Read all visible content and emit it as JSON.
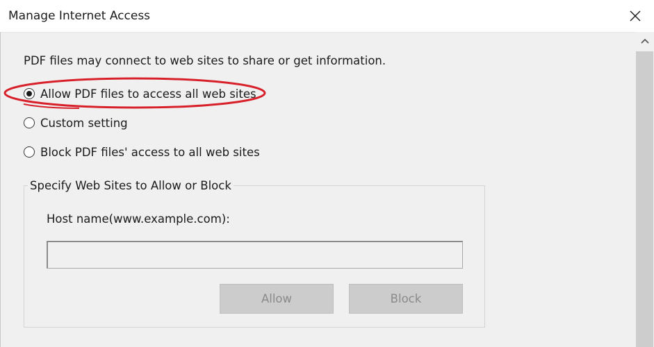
{
  "window": {
    "title": "Manage Internet Access",
    "close_icon": "close-icon"
  },
  "description": "PDF files may connect to web sites to share or get information.",
  "options": [
    {
      "label": "Allow PDF files to access all web sites",
      "selected": true
    },
    {
      "label": "Custom setting",
      "selected": false
    },
    {
      "label": "Block PDF files' access to all web sites",
      "selected": false
    }
  ],
  "group": {
    "title": "Specify Web Sites to Allow or Block",
    "host_label": "Host name(www.example.com):",
    "host_value": "",
    "allow_button": "Allow",
    "block_button": "Block"
  },
  "colors": {
    "annotation": "#d8202a",
    "disabled_button_bg": "#cccccc",
    "disabled_button_text": "#8a8a8a"
  },
  "scrollbar": {
    "up_icon": "chevron-up-icon"
  }
}
